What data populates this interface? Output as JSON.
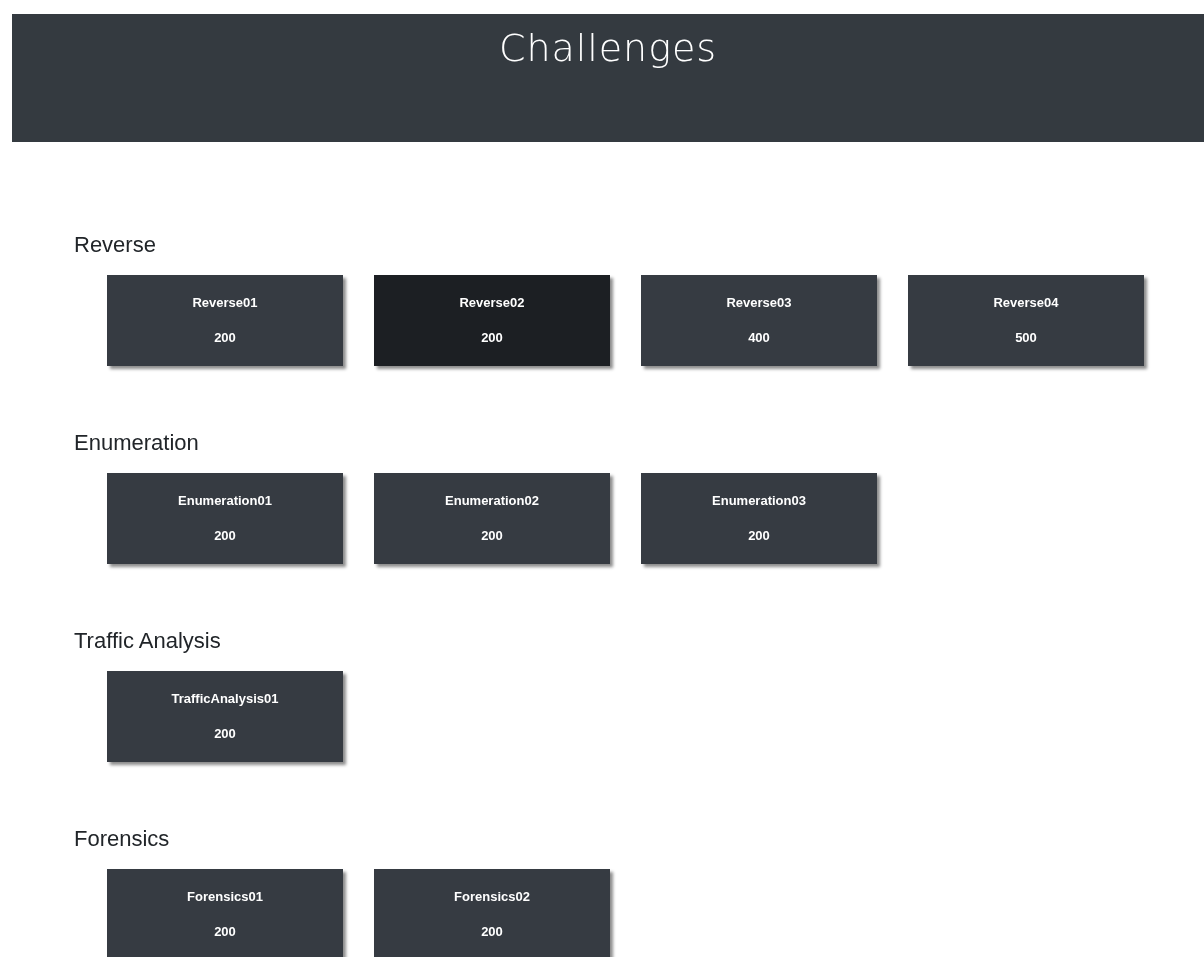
{
  "header": {
    "title": "Challenges"
  },
  "categories": [
    {
      "name": "Reverse",
      "challenges": [
        {
          "name": "Reverse01",
          "points": "200",
          "hovered": false
        },
        {
          "name": "Reverse02",
          "points": "200",
          "hovered": true
        },
        {
          "name": "Reverse03",
          "points": "400",
          "hovered": false
        },
        {
          "name": "Reverse04",
          "points": "500",
          "hovered": false
        }
      ]
    },
    {
      "name": "Enumeration",
      "challenges": [
        {
          "name": "Enumeration01",
          "points": "200",
          "hovered": false
        },
        {
          "name": "Enumeration02",
          "points": "200",
          "hovered": false
        },
        {
          "name": "Enumeration03",
          "points": "200",
          "hovered": false
        }
      ]
    },
    {
      "name": "Traffic Analysis",
      "challenges": [
        {
          "name": "TrafficAnalysis01",
          "points": "200",
          "hovered": false
        }
      ]
    },
    {
      "name": "Forensics",
      "challenges": [
        {
          "name": "Forensics01",
          "points": "200",
          "hovered": false
        },
        {
          "name": "Forensics02",
          "points": "200",
          "hovered": false
        }
      ]
    }
  ]
}
